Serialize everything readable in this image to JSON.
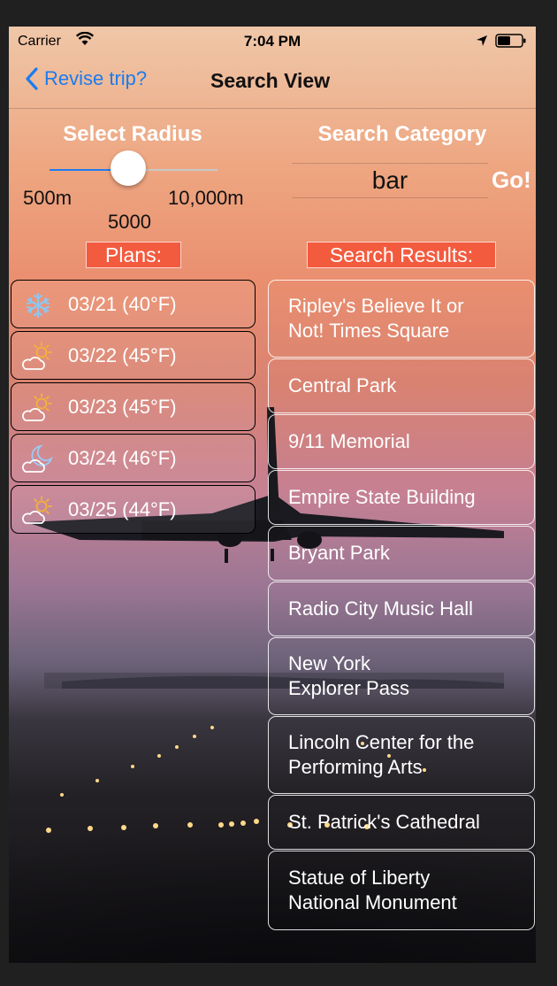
{
  "status_bar": {
    "carrier": "Carrier",
    "time": "7:04 PM"
  },
  "nav": {
    "back_label": "Revise trip?",
    "title": "Search View"
  },
  "radius": {
    "header": "Select Radius",
    "min_label": "500m",
    "max_label": "10,000m",
    "value_label": "5000",
    "value_fraction": 0.47
  },
  "search": {
    "header": "Search Category",
    "query": "bar",
    "go_label": "Go!"
  },
  "plans": {
    "header": "Plans:",
    "items": [
      {
        "label": "03/21 (40°F)",
        "icon": "snowflake-icon"
      },
      {
        "label": "03/22 (45°F)",
        "icon": "partly-sunny-icon"
      },
      {
        "label": "03/23 (45°F)",
        "icon": "partly-sunny-icon"
      },
      {
        "label": "03/24 (46°F)",
        "icon": "moon-cloud-icon"
      },
      {
        "label": "03/25 (44°F)",
        "icon": "partly-sunny-icon"
      }
    ]
  },
  "results": {
    "header": "Search Results:",
    "items": [
      "Ripley's Believe It or\nNot! Times Square",
      "Central Park",
      "9/11 Memorial",
      "Empire State Building",
      "Bryant Park",
      "Radio City Music Hall",
      "New York\nExplorer Pass",
      "Lincoln Center for the\nPerforming Arts",
      "St. Patrick's Cathedral",
      "Statue of Liberty\nNational Monument"
    ]
  },
  "colors": {
    "accent": "#1f7df0",
    "tag": "#f35b3f"
  }
}
